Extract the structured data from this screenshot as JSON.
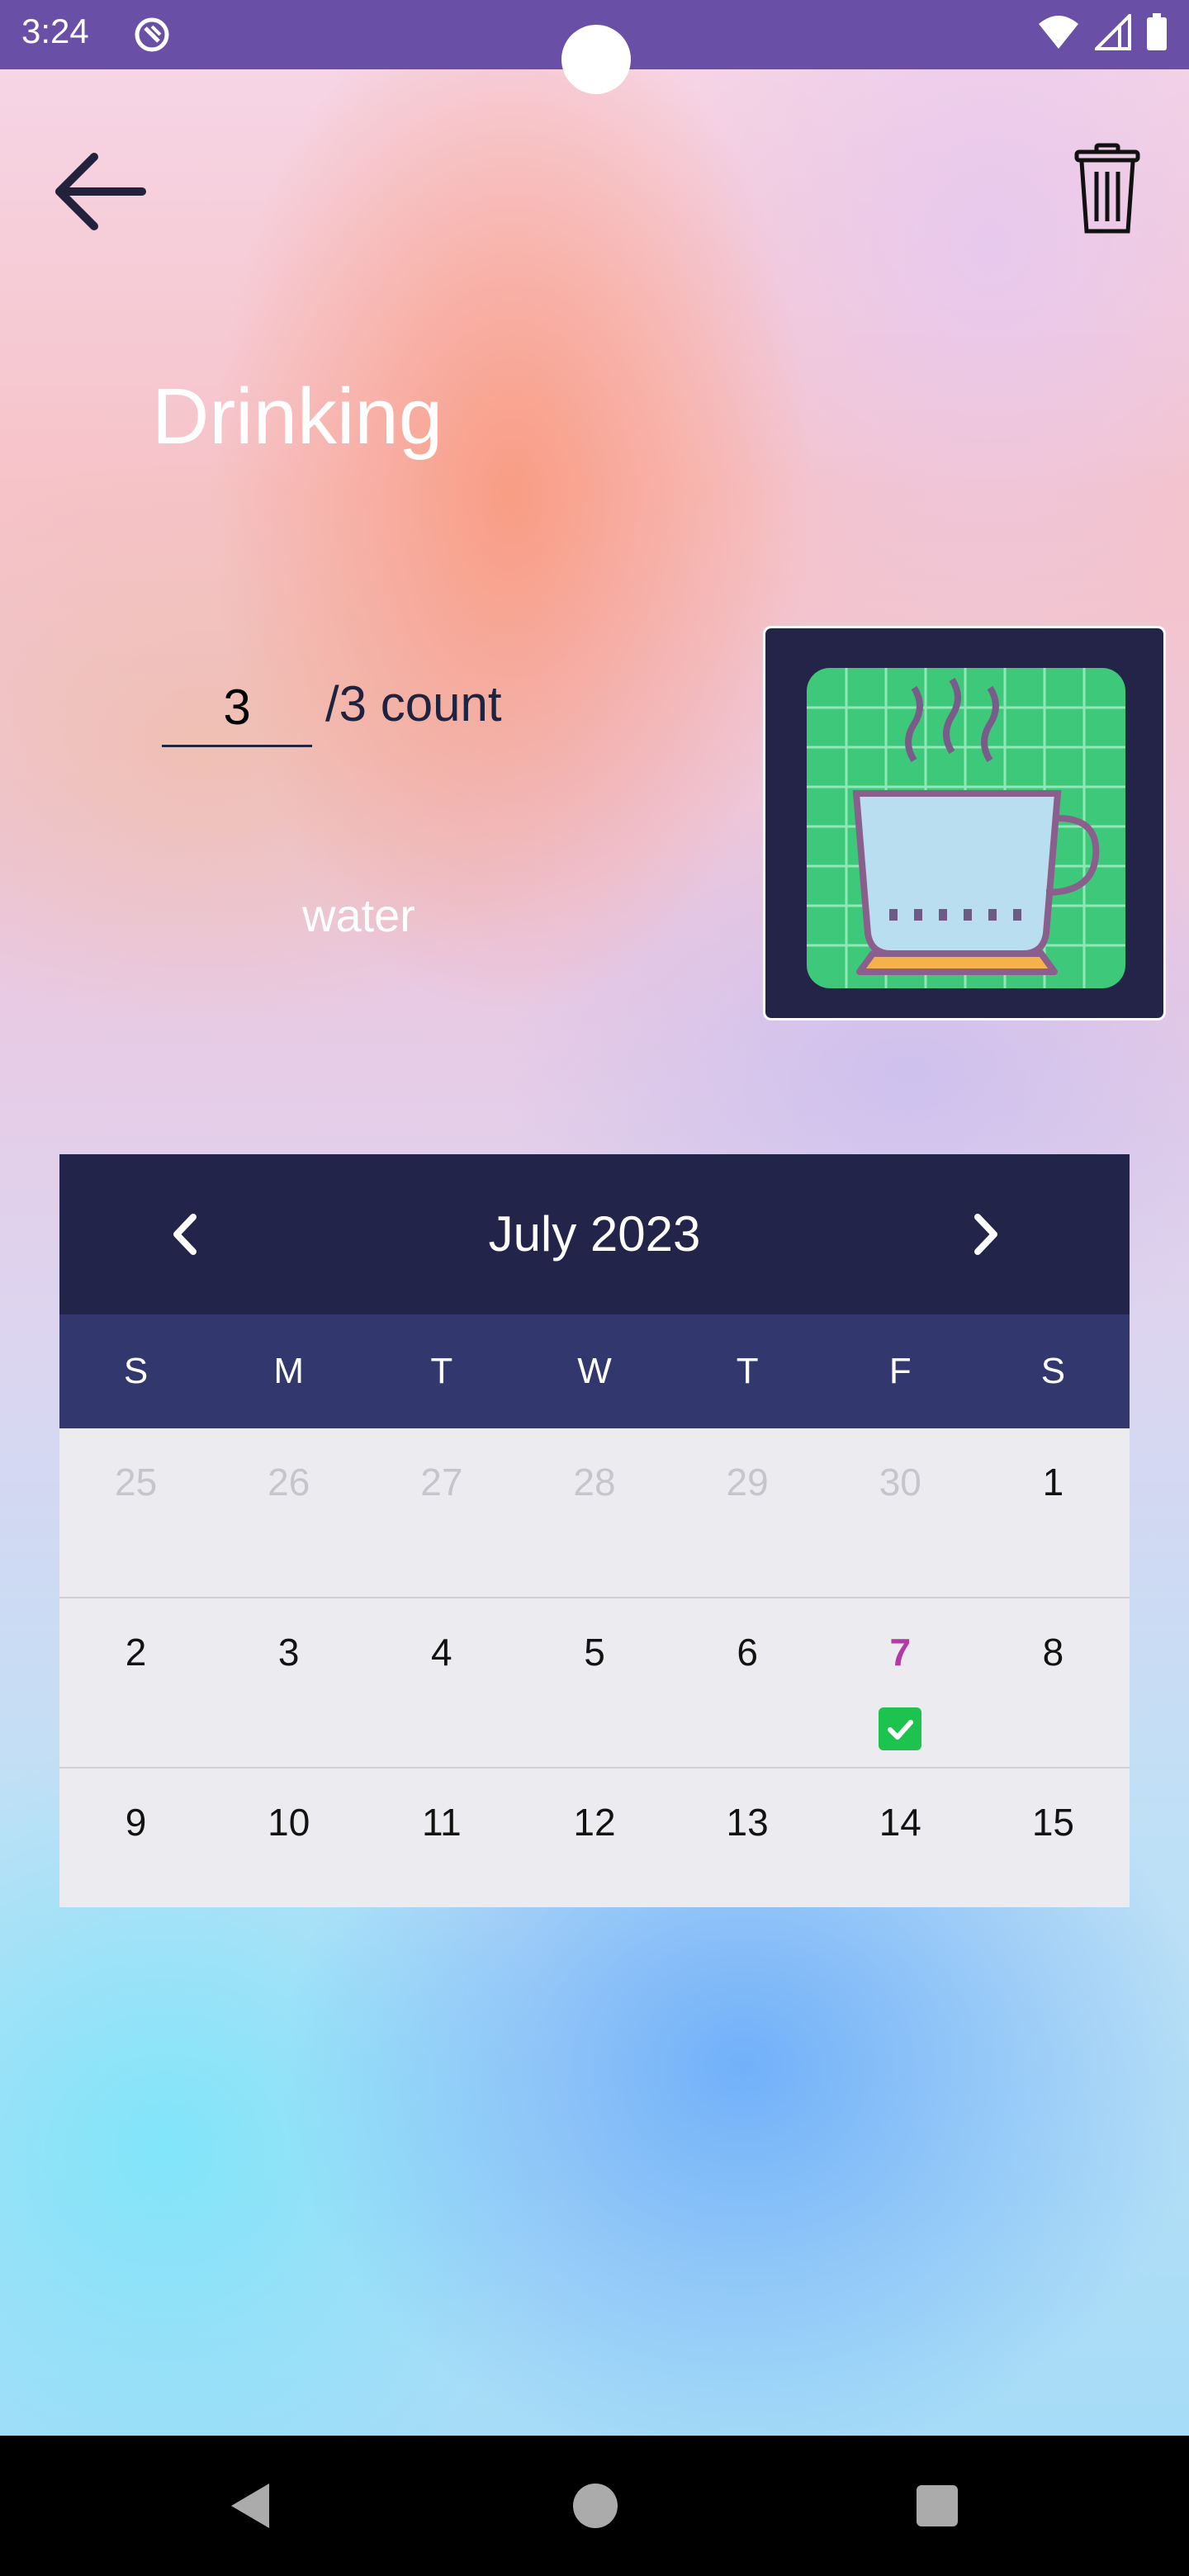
{
  "status_bar": {
    "time": "3:24",
    "icons": [
      "app-notification-icon",
      "wifi-icon",
      "signal-icon",
      "battery-icon"
    ],
    "bg_color": "#6a4fa6"
  },
  "toolbar": {
    "back_icon": "arrow-left-icon",
    "delete_icon": "trash-icon"
  },
  "habit": {
    "title": "Drinking",
    "count_value": "3",
    "count_label": "/3 count",
    "description": "water",
    "image": "coffee-cup-icon"
  },
  "calendar": {
    "month_label": "July  2023",
    "prev_icon": "chevron-left-icon",
    "next_icon": "chevron-right-icon",
    "weekdays": [
      "S",
      "M",
      "T",
      "W",
      "T",
      "F",
      "S"
    ],
    "weeks": [
      [
        "25",
        "26",
        "27",
        "28",
        "29",
        "30",
        "1"
      ],
      [
        "2",
        "3",
        "4",
        "5",
        "6",
        "7",
        "8"
      ],
      [
        "9",
        "10",
        "11",
        "12",
        "13",
        "14",
        "15"
      ]
    ],
    "today": "7",
    "completed_days": [
      "7"
    ],
    "header_color": "#22244a",
    "weekday_bar_color": "#32376e",
    "today_color": "#b23aa6",
    "check_color": "#1ec24f"
  },
  "nav_bar": {
    "icons": [
      "nav-back-icon",
      "nav-home-icon",
      "nav-recents-icon"
    ]
  }
}
